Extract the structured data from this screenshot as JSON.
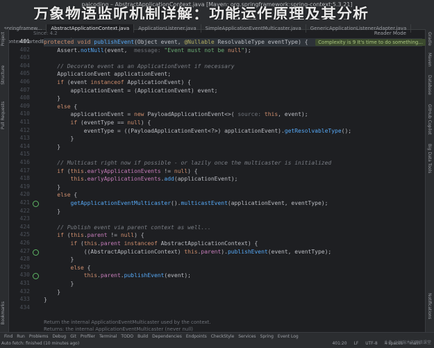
{
  "window": {
    "title": "paicoding – AbstractApplicationContext.java [Maven: org.springframework:spring-context:5.3.21]",
    "overlay_title": "万象物语监听机制详解：功能运作原理及其分析"
  },
  "tabs": [
    {
      "label": "springframew..."
    },
    {
      "label": "AbstractApplicationContext.java",
      "active": true
    },
    {
      "label": "ApplicationListener.java"
    },
    {
      "label": "SimpleApplicationEventMulticaster.java"
    },
    {
      "label": "GenericApplicationListenerAdapter.java"
    },
    {
      "label": "ContextStartedEvent.java"
    }
  ],
  "left_tools": [
    "Project",
    "Structure",
    "Pull Requests",
    "Bookmarks"
  ],
  "right_tools": [
    "Gradle",
    "Maven",
    "Database",
    "GitHub Copilot",
    "Big Data Tools",
    "Notifications"
  ],
  "header": {
    "since": "Since:  4.2",
    "reader_mode": "Reader Mode"
  },
  "complexity_hint": "Complexity is 9 It's time to do something...",
  "code_lines": [
    {
      "num": "401",
      "text": "protected void publishEvent(Object event, @Nullable ResolvableType eventType) {"
    },
    {
      "num": "402",
      "text": "    Assert.notNull(event,  message: \"Event must not be null\");"
    },
    {
      "num": "403",
      "text": ""
    },
    {
      "num": "404",
      "text": "    // Decorate event as an ApplicationEvent if necessary"
    },
    {
      "num": "405",
      "text": "    ApplicationEvent applicationEvent;"
    },
    {
      "num": "406",
      "text": "    if (event instanceof ApplicationEvent) {"
    },
    {
      "num": "407",
      "text": "        applicationEvent = (ApplicationEvent) event;"
    },
    {
      "num": "408",
      "text": "    }"
    },
    {
      "num": "409",
      "text": "    else {"
    },
    {
      "num": "410",
      "text": "        applicationEvent = new PayloadApplicationEvent<>( source: this, event);"
    },
    {
      "num": "411",
      "text": "        if (eventType == null) {"
    },
    {
      "num": "412",
      "text": "            eventType = ((PayloadApplicationEvent<?>) applicationEvent).getResolvableType();"
    },
    {
      "num": "413",
      "text": "        }"
    },
    {
      "num": "414",
      "text": "    }"
    },
    {
      "num": "415",
      "text": ""
    },
    {
      "num": "416",
      "text": "    // Multicast right now if possible - or lazily once the multicaster is initialized"
    },
    {
      "num": "417",
      "text": "    if (this.earlyApplicationEvents != null) {"
    },
    {
      "num": "418",
      "text": "        this.earlyApplicationEvents.add(applicationEvent);"
    },
    {
      "num": "419",
      "text": "    }"
    },
    {
      "num": "420",
      "text": "    else {"
    },
    {
      "num": "421",
      "text": "        getApplicationEventMulticaster().multicastEvent(applicationEvent, eventType);"
    },
    {
      "num": "422",
      "text": "    }"
    },
    {
      "num": "423",
      "text": ""
    },
    {
      "num": "424",
      "text": "    // Publish event via parent context as well..."
    },
    {
      "num": "425",
      "text": "    if (this.parent != null) {"
    },
    {
      "num": "426",
      "text": "        if (this.parent instanceof AbstractApplicationContext) {"
    },
    {
      "num": "427",
      "text": "            ((AbstractApplicationContext) this.parent).publishEvent(event, eventType);"
    },
    {
      "num": "428",
      "text": "        }"
    },
    {
      "num": "429",
      "text": "        else {"
    },
    {
      "num": "430",
      "text": "            this.parent.publishEvent(event);"
    },
    {
      "num": "431",
      "text": "        }"
    },
    {
      "num": "432",
      "text": "    }"
    },
    {
      "num": "433",
      "text": "}"
    },
    {
      "num": "434",
      "text": ""
    }
  ],
  "doc_comment": [
    "Return the internal ApplicationEventMulticaster used by the context.",
    "Returns: the internal ApplicationEventMulticaster (never null)"
  ],
  "bottom_tools": [
    "Find",
    "Run",
    "Problems",
    "Debug",
    "Git",
    "Profiler",
    "Terminal",
    "TODO",
    "Build",
    "Dependencies",
    "Endpoints",
    "CheckStyle",
    "Services",
    "Spring",
    "Event Log"
  ],
  "status": {
    "left": "Auto fetch: finished (10 minutes ago)",
    "position": "401:20",
    "line_sep": "LF",
    "encoding": "UTF-8",
    "indent": "4 spaces",
    "branch": "main"
  },
  "watermark": "头条 @林瑞木的网络课堂"
}
